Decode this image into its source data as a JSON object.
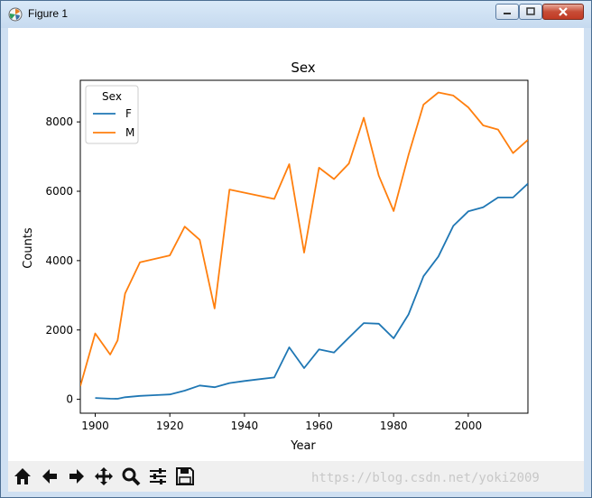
{
  "window": {
    "title": "Figure 1"
  },
  "toolbar": {
    "buttons": [
      {
        "name": "home-icon"
      },
      {
        "name": "back-arrow-icon"
      },
      {
        "name": "forward-arrow-icon"
      },
      {
        "name": "pan-icon"
      },
      {
        "name": "zoom-icon"
      },
      {
        "name": "configure-subplots-icon"
      },
      {
        "name": "save-icon"
      }
    ]
  },
  "watermark": "https://blog.csdn.net/yoki2009",
  "chart_data": {
    "type": "line",
    "title": "Sex",
    "xlabel": "Year",
    "ylabel": "Counts",
    "xlim": [
      1896,
      2016
    ],
    "ylim": [
      -400,
      9200
    ],
    "xticks": [
      1900,
      1920,
      1940,
      1960,
      1980,
      2000
    ],
    "yticks": [
      0,
      2000,
      4000,
      6000,
      8000
    ],
    "legend": {
      "title": "Sex",
      "position": "top-left"
    },
    "grid": false,
    "series": [
      {
        "name": "F",
        "color": "#1f77b4",
        "points": [
          [
            1900,
            40
          ],
          [
            1904,
            20
          ],
          [
            1906,
            15
          ],
          [
            1908,
            60
          ],
          [
            1912,
            100
          ],
          [
            1916,
            120
          ],
          [
            1920,
            140
          ],
          [
            1924,
            250
          ],
          [
            1928,
            400
          ],
          [
            1932,
            350
          ],
          [
            1936,
            470
          ],
          [
            1940,
            530
          ],
          [
            1944,
            580
          ],
          [
            1948,
            630
          ],
          [
            1952,
            1500
          ],
          [
            1956,
            900
          ],
          [
            1960,
            1440
          ],
          [
            1964,
            1350
          ],
          [
            1968,
            1780
          ],
          [
            1972,
            2200
          ],
          [
            1976,
            2180
          ],
          [
            1980,
            1760
          ],
          [
            1984,
            2450
          ],
          [
            1988,
            3550
          ],
          [
            1992,
            4120
          ],
          [
            1996,
            5000
          ],
          [
            2000,
            5420
          ],
          [
            2004,
            5540
          ],
          [
            2008,
            5820
          ],
          [
            2012,
            5820
          ],
          [
            2016,
            6220
          ]
        ]
      },
      {
        "name": "M",
        "color": "#ff7f0e",
        "points": [
          [
            1896,
            380
          ],
          [
            1900,
            1900
          ],
          [
            1904,
            1290
          ],
          [
            1906,
            1700
          ],
          [
            1908,
            3050
          ],
          [
            1912,
            3950
          ],
          [
            1920,
            4150
          ],
          [
            1924,
            4980
          ],
          [
            1928,
            4600
          ],
          [
            1932,
            2620
          ],
          [
            1936,
            6050
          ],
          [
            1948,
            5780
          ],
          [
            1952,
            6780
          ],
          [
            1956,
            4230
          ],
          [
            1960,
            6680
          ],
          [
            1964,
            6350
          ],
          [
            1968,
            6800
          ],
          [
            1972,
            8120
          ],
          [
            1976,
            6450
          ],
          [
            1980,
            5430
          ],
          [
            1984,
            7050
          ],
          [
            1988,
            8500
          ],
          [
            1992,
            8850
          ],
          [
            1996,
            8760
          ],
          [
            2000,
            8420
          ],
          [
            2004,
            7900
          ],
          [
            2008,
            7780
          ],
          [
            2012,
            7100
          ],
          [
            2016,
            7480
          ]
        ]
      }
    ]
  }
}
